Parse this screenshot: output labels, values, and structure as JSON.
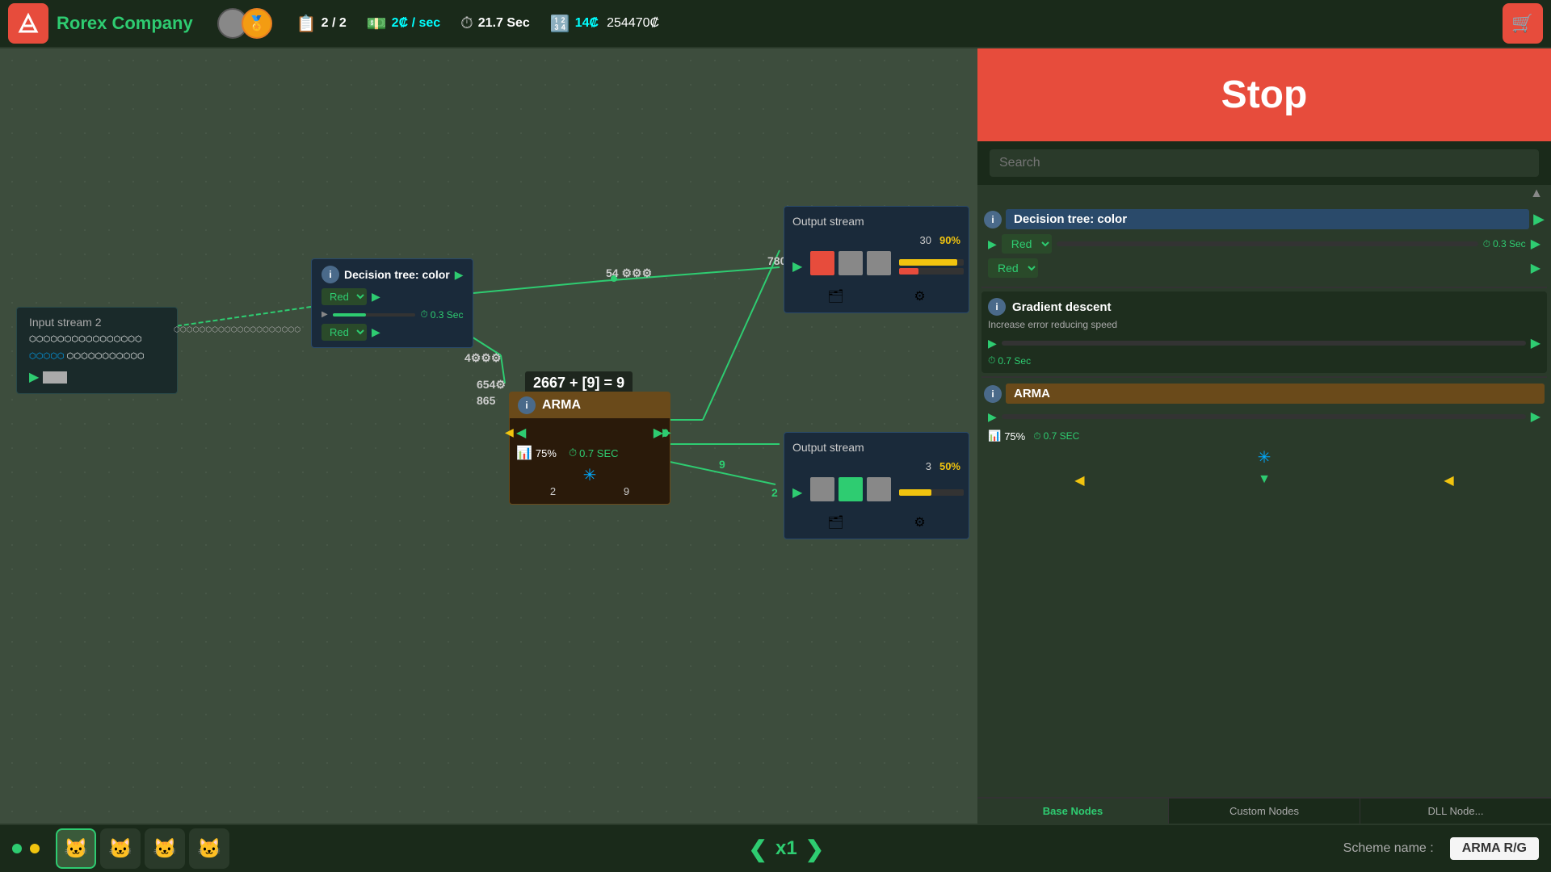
{
  "company": {
    "name": "Rorex Company",
    "logo": "arrow-icon"
  },
  "topbar": {
    "missions": "2 / 2",
    "income_rate": "2₡ / sec",
    "timer": "21.7 Sec",
    "currency_small": "14₡",
    "currency_large": "254470₡",
    "missions_icon": "📋",
    "income_icon": "💵",
    "timer_icon": "⏱",
    "calc_icon": "🔢"
  },
  "stop_button": {
    "label": "Stop"
  },
  "search": {
    "placeholder": "Search"
  },
  "right_panel": {
    "nodes": [
      {
        "id": "decision-tree-1",
        "type": "decision_tree",
        "title": "Decision tree: color",
        "dropdown1": "Red",
        "dropdown2": "Red",
        "speed": "0.3 Sec",
        "info": true
      },
      {
        "id": "gradient-descent-1",
        "type": "gradient_descent",
        "title": "Gradient descent",
        "description": "Increase error reducing speed",
        "speed": "0.7 Sec",
        "info": true
      },
      {
        "id": "arma-1",
        "type": "arma",
        "title": "ARMA",
        "bar_pct": 75,
        "speed": "0.7 SEC",
        "info": true
      }
    ]
  },
  "output_stream_top": {
    "label": "Output stream",
    "count": 30,
    "percentage": "90%",
    "colors": [
      "#e74c3c",
      "#888",
      "#888"
    ]
  },
  "output_stream_bottom": {
    "label": "Output stream",
    "count": 3,
    "percentage": "50%",
    "colors": [
      "#888",
      "#2ecc71",
      "#888"
    ]
  },
  "input_stream": {
    "label": "Input stream 2"
  },
  "canvas": {
    "decision_tree_node": {
      "title": "Decision tree: color",
      "dropdown1": "Red",
      "dropdown2": "Red",
      "speed": "0.3 Sec"
    },
    "arma_node": {
      "title": "ARMA",
      "equation": "2667 + [9] = 9",
      "bar_pct": 75,
      "speed": "0.7 SEC"
    },
    "labels": {
      "label_54": "54",
      "label_780": "780",
      "label_4": "4",
      "label_654": "654",
      "label_865": "865",
      "label_2": "2",
      "label_9a": "9",
      "label_9b": "9",
      "label_2b": "2"
    }
  },
  "bottom_bar": {
    "speed_label": "x1",
    "scheme_label": "Scheme name :",
    "scheme_name": "ARMA R/G",
    "left_arrow": "❮",
    "right_arrow": "❯"
  },
  "tabs": {
    "base": "Base\nNodes",
    "custom": "Custom\nNodes",
    "dll": "DLL\nNode..."
  }
}
